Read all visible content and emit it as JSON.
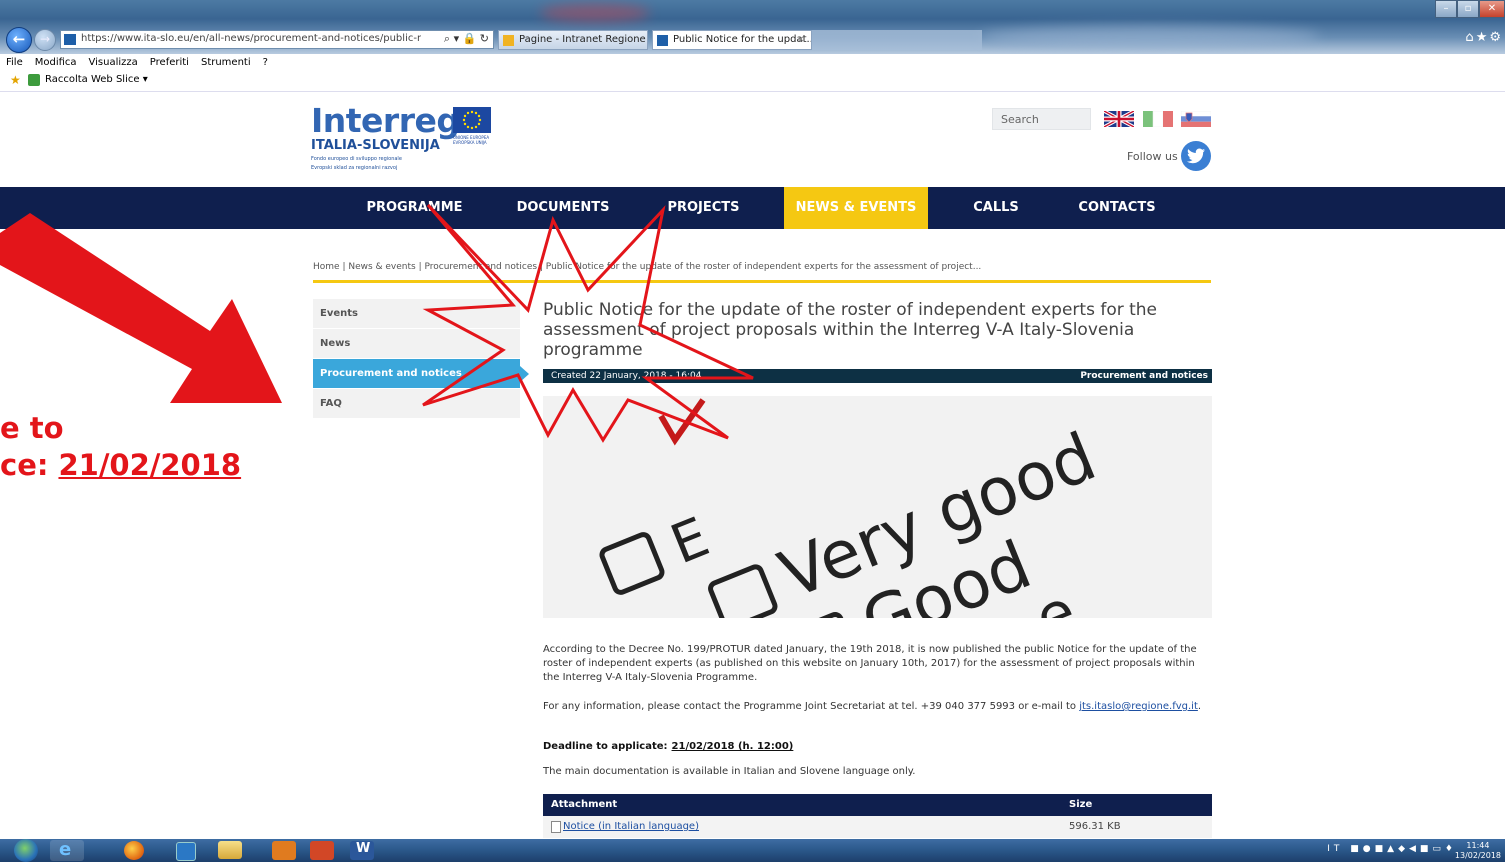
{
  "browser": {
    "url": "https://www.ita-slo.eu/en/all-news/procurement-and-notices/public-notice-update",
    "url_domain": "ita-slo.eu",
    "tabs": [
      {
        "label": "Pagine - Intranet Regione FVG"
      },
      {
        "label": "Public Notice for the updat..."
      }
    ],
    "menu": [
      "File",
      "Modifica",
      "Visualizza",
      "Preferiti",
      "Strumenti",
      "?"
    ],
    "favorites_label": "Raccolta Web Slice ▾"
  },
  "site": {
    "logo_word": "Interreg",
    "logo_region": "ITALIA-SLOVENIJA",
    "logo_tagline_1": "Fondo europeo di sviluppo regionale",
    "logo_tagline_2": "Evropski sklad za regionalni razvoj",
    "eu_text_1": "UNIONE EUROPEA",
    "eu_text_2": "EVROPSKA UNIJA",
    "search_placeholder": "Search",
    "follow_label": "Follow us",
    "nav": [
      "PROGRAMME",
      "DOCUMENTS",
      "PROJECTS",
      "NEWS & EVENTS",
      "CALLS",
      "CONTACTS"
    ],
    "nav_active": "NEWS & EVENTS",
    "accent_color": "#f5c812",
    "nav_color": "#0f1f4e"
  },
  "breadcrumb": {
    "text": "Home | News & events | Procurement and notices | Public Notice for the update of the roster of independent experts for the assessment of project..."
  },
  "sidebar": {
    "items": [
      {
        "label": "Events"
      },
      {
        "label": "News"
      },
      {
        "label": "Procurement and notices"
      },
      {
        "label": "FAQ"
      }
    ]
  },
  "article": {
    "title": "Public Notice for the update of the roster of independent experts for the assessment of project proposals within the Interreg V-A Italy-Slovenia programme",
    "created": "Created 22 January, 2018 - 16:04",
    "category": "Procurement and notices",
    "image_words": [
      "Very good",
      "Good",
      "E",
      "e"
    ],
    "paragraph_1": "According to the Decree No. 199/PROTUR dated January, the 19th 2018, it is now published the public Notice for the update of the roster of independent experts  (as published on this website on January 10th, 2017) for the assessment of project proposals within the Interreg V-A Italy-Slovenia Programme.",
    "paragraph_2_a": "For any information, please contact the Programme Joint Secretariat at tel. +39 040 377 5993 or e-mail to",
    "email": "jts.itaslo@regione.fvg.it",
    "deadline_label": "Deadline to applicate:",
    "deadline_value": "21/02/2018 (h. 12:00)",
    "paragraph_3": "The main documentation is available in Italian and Slovene language only.",
    "attachments": {
      "headers": [
        "Attachment",
        "Size"
      ],
      "rows": [
        {
          "name": "Notice (in Italian language)",
          "size": "596.31 KB"
        }
      ]
    }
  },
  "annotation": {
    "callout_line_1": "e to",
    "callout_line_2": "ce:",
    "callout_date": "21/02/2018",
    "color": "#e3151a"
  },
  "taskbar": {
    "lang": "IT",
    "time": "11:44",
    "date": "13/02/2018"
  }
}
